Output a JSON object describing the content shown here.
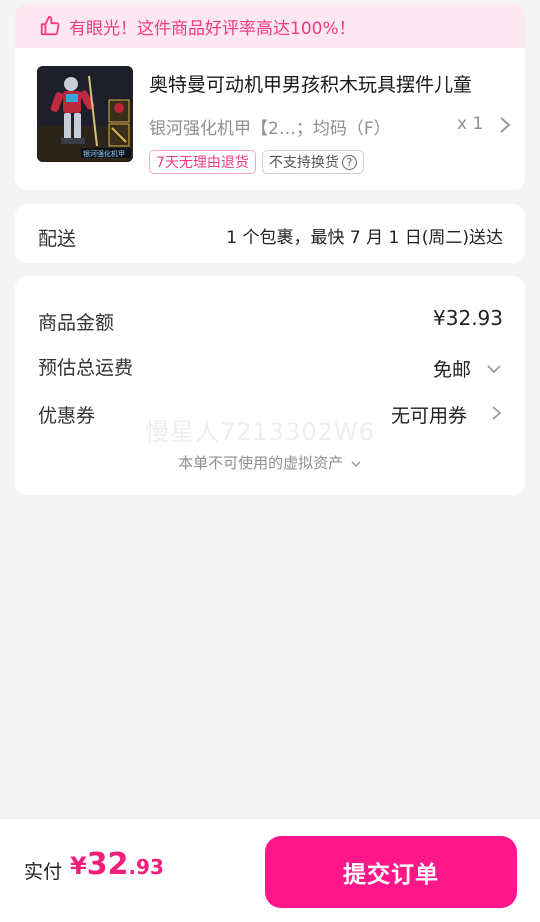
{
  "product": {
    "praise_banner": "有眼光！这件商品好评率高达100%！",
    "title": "奥特曼可动机甲男孩积木玩具摆件儿童",
    "spec": "银河强化机甲【2…；均码（F）",
    "quantity": "x 1",
    "tags": {
      "return": "7天无理由退货",
      "no_exchange": "不支持换货"
    },
    "image_caption": "银河强化机甲",
    "icons": {
      "praise": "thumbs-up-icon",
      "arrow": "chevron-right-icon",
      "help": "question-circle-icon"
    }
  },
  "delivery": {
    "label": "配送",
    "value": "1 个包裹，最快 7 月 1 日(周二)送达"
  },
  "price": {
    "goods_label": "商品金额",
    "goods_value": "¥32.93",
    "shipping_label": "预估总运费",
    "shipping_value": "免邮",
    "coupon_label": "优惠券",
    "coupon_value": "无可用券",
    "virtual_assets": "本单不可使用的虚拟资产",
    "watermark": "慢星人7213302W6"
  },
  "footer": {
    "pay_label": "实付",
    "amount_symbol": "¥",
    "amount_integer": "32",
    "amount_decimal": ".93",
    "submit_label": "提交订单"
  },
  "colors": {
    "accent": "#ff1688",
    "price_accent": "#f01f7a",
    "banner_bg": "#fde8f1",
    "page_bg": "#f4f4f5"
  }
}
